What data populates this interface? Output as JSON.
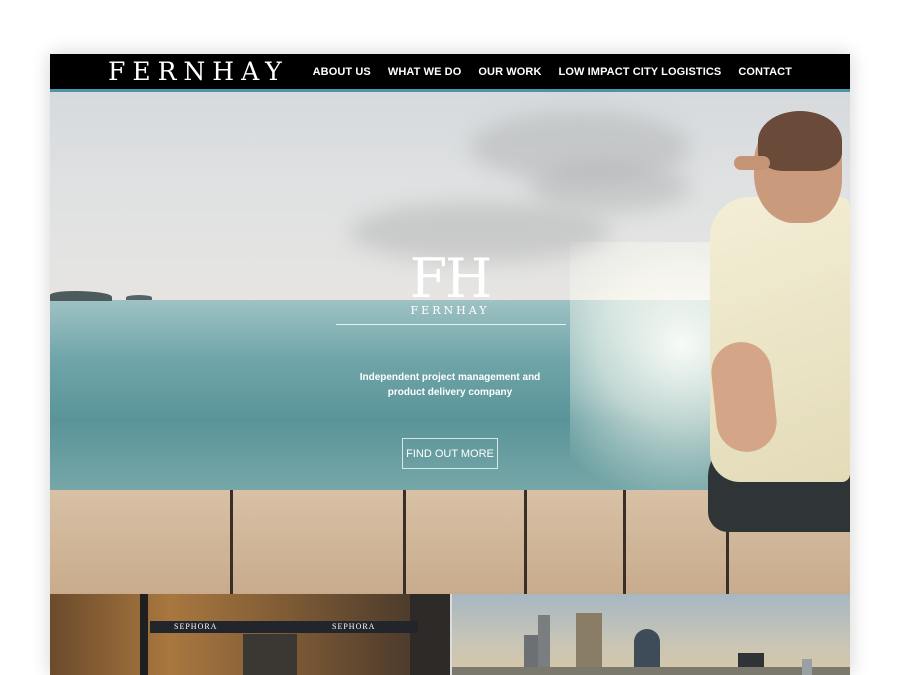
{
  "header": {
    "logo": "FERNHAY",
    "nav": [
      "ABOUT US",
      "WHAT WE DO",
      "OUR WORK",
      "LOW IMPACT CITY LOGISTICS",
      "CONTACT"
    ]
  },
  "hero": {
    "monogram": "FH",
    "wordmark": "FERNHAY",
    "tagline_line1": "Independent project management and",
    "tagline_line2": "product delivery company",
    "cta": "FIND OUT MORE"
  },
  "tiles": {
    "left_sign_1": "SEPHORA",
    "left_sign_2": "SEPHORA"
  },
  "colors": {
    "nav_bg": "#000000",
    "nav_accent": "#4a96a8"
  }
}
